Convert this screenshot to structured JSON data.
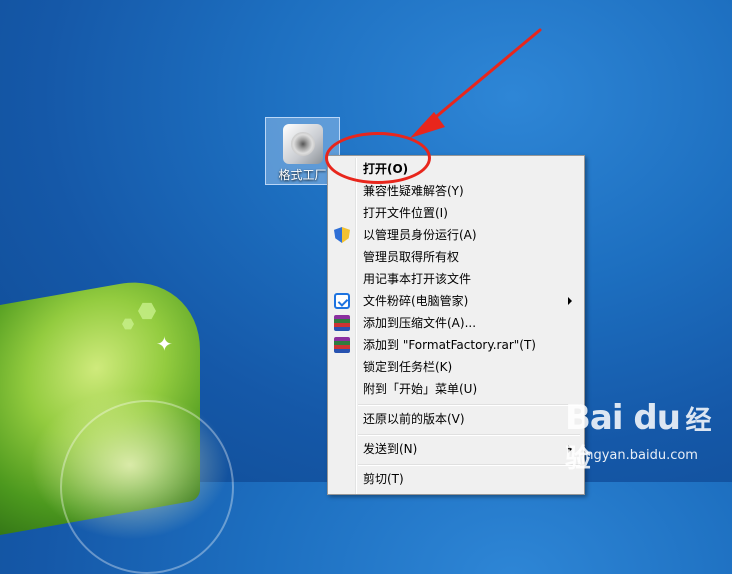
{
  "desktop": {
    "icon": {
      "label": "格式工厂",
      "icon": "format-factory-icon"
    }
  },
  "context_menu": {
    "items": [
      {
        "label": "打开(O)",
        "bold": true,
        "icon": null,
        "submenu": false
      },
      {
        "label": "兼容性疑难解答(Y)",
        "icon": null,
        "submenu": false
      },
      {
        "label": "打开文件位置(I)",
        "icon": null,
        "submenu": false
      },
      {
        "label": "以管理员身份运行(A)",
        "icon": "uac-shield-icon",
        "submenu": false
      },
      {
        "label": "管理员取得所有权",
        "icon": null,
        "submenu": false
      },
      {
        "label": "用记事本打开该文件",
        "icon": null,
        "submenu": false
      },
      {
        "label": "文件粉碎(电脑管家)",
        "icon": "pc-manager-icon",
        "submenu": true
      },
      {
        "label": "添加到压缩文件(A)...",
        "icon": "winrar-icon",
        "submenu": false
      },
      {
        "label": "添加到 \"FormatFactory.rar\"(T)",
        "icon": "winrar-icon",
        "submenu": false
      },
      {
        "label": "锁定到任务栏(K)",
        "icon": null,
        "submenu": false
      },
      {
        "label": "附到「开始」菜单(U)",
        "icon": null,
        "submenu": false
      },
      {
        "label": "还原以前的版本(V)",
        "icon": null,
        "submenu": false
      },
      {
        "label": "发送到(N)",
        "icon": null,
        "submenu": true
      },
      {
        "label": "剪切(T)",
        "icon": null,
        "submenu": false
      }
    ]
  },
  "watermark": {
    "logo": "Bai du",
    "text": "经验",
    "url": "jingyan.baidu.com"
  },
  "colors": {
    "annotation": "#e8261c",
    "menu_bg": "#f0f0f0"
  }
}
